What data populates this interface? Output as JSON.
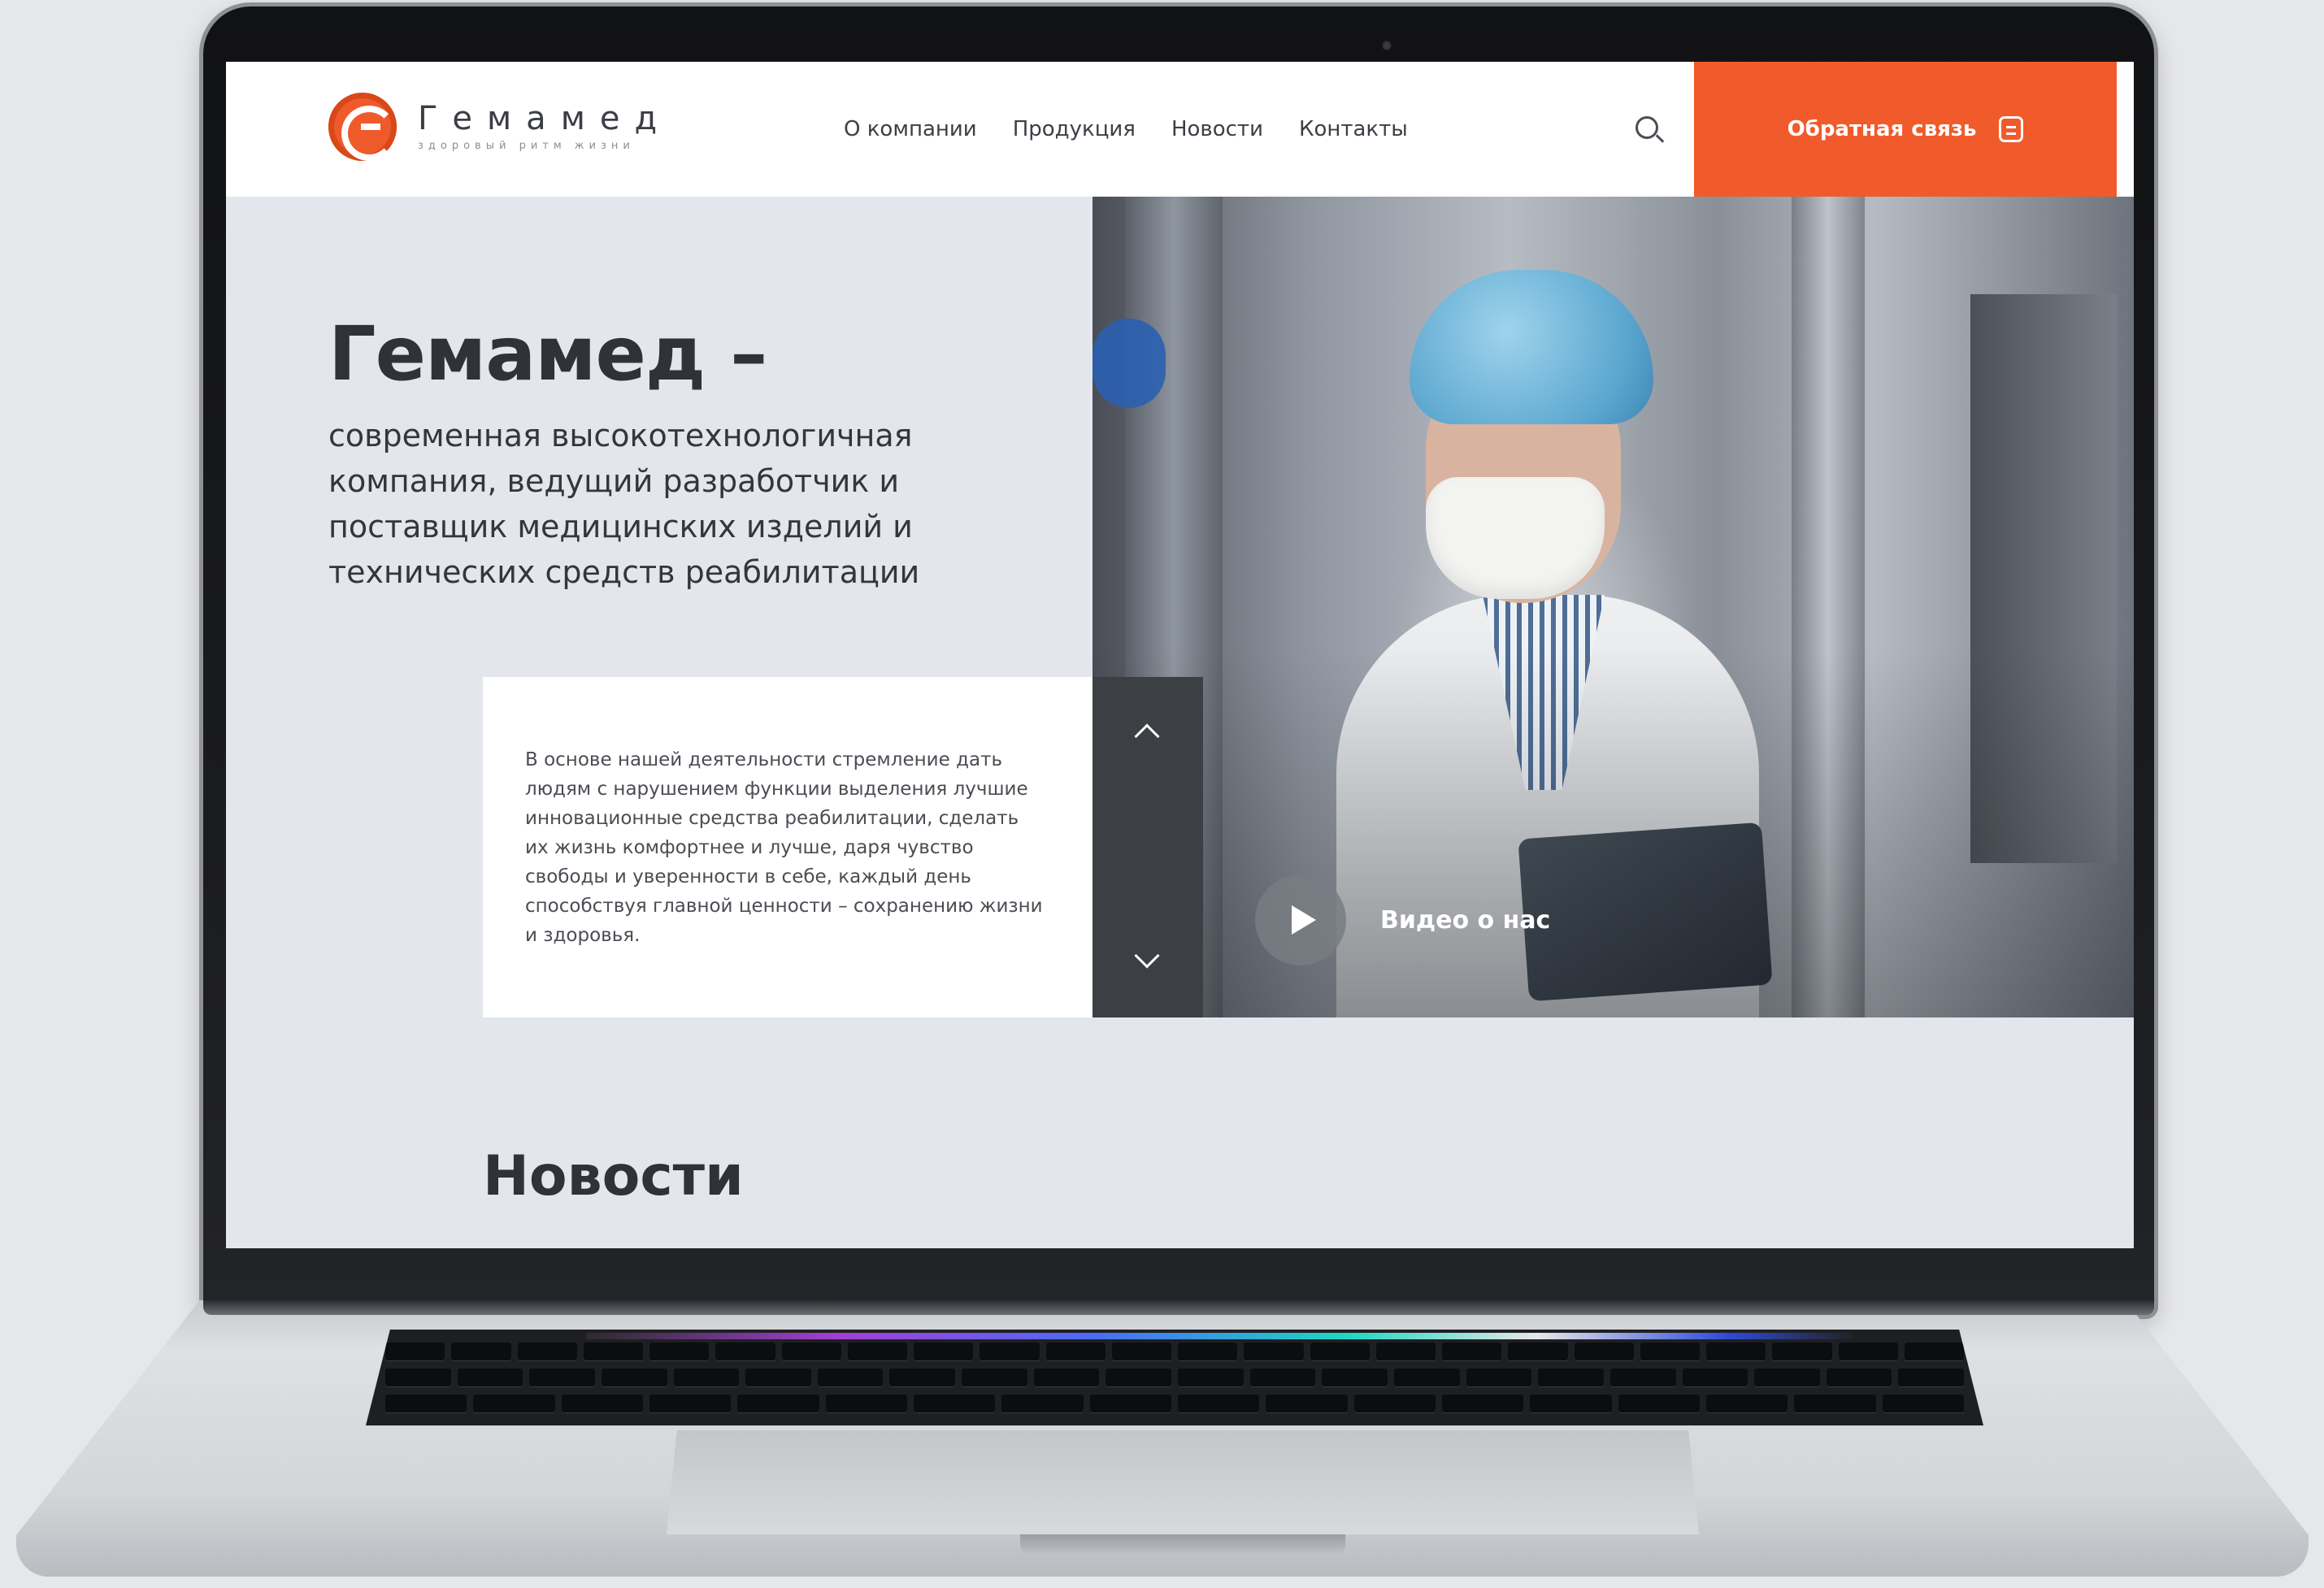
{
  "header": {
    "logo_name": "Гемамед",
    "logo_tagline": "здоровый ритм жизни",
    "nav": [
      "О компании",
      "Продукция",
      "Новости",
      "Контакты"
    ],
    "feedback_label": "Обратная связь"
  },
  "hero": {
    "title": "Гемамед –",
    "subtitle": "современная высокотехнологичная компания, ведущий разработчик и поставщик медицинских изделий и технических средств реабилитации",
    "about": "В основе нашей деятельности стремление дать людям с нарушением функции выделения лучшие инновационные средства реабилитации, сделать их жизнь комфортнее и лучше, даря чувство свободы и уверенности в себе, каждый день способствуя главной ценности – сохранению жизни и здоровья.",
    "video_label": "Видео о нас"
  },
  "news": {
    "title": "Новости"
  },
  "colors": {
    "accent": "#f15a2b",
    "text_dark": "#2f3237",
    "hero_bg": "#e3e6ed",
    "slider_bg": "#3c3f44"
  },
  "icons": [
    "logo-icon",
    "search-icon",
    "feedback-icon",
    "chevron-up-icon",
    "chevron-down-icon",
    "play-icon"
  ]
}
